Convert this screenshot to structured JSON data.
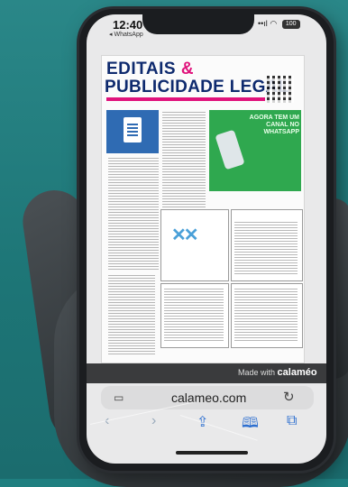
{
  "status": {
    "time": "12:40",
    "back_app": "◂ WhatsApp",
    "signal": "••ıl",
    "wifi": "◠",
    "battery": "100"
  },
  "doc": {
    "title_line1": "EDITAIS",
    "title_amp": "&",
    "title_line2": "PUBLICIDADE LEGAL",
    "ad_text": "AGORA TEM UM CANAL NO WHATSAPP"
  },
  "browser": {
    "made_with": "Made with",
    "brand": "calaméo",
    "url": "calameo.com"
  },
  "icons": {
    "tabs": "tabs-icon",
    "reload": "reload-icon",
    "back": "back-arrow-icon",
    "forward": "forward-arrow-icon",
    "share": "share-icon",
    "bookmarks": "bookmarks-icon",
    "windows": "tab-windows-icon"
  },
  "colors": {
    "background": "#1f7f80",
    "title": "#0e2a6e",
    "accent": "#e0137c",
    "ad": "#2fa84f",
    "link": "#2d6fd0"
  }
}
